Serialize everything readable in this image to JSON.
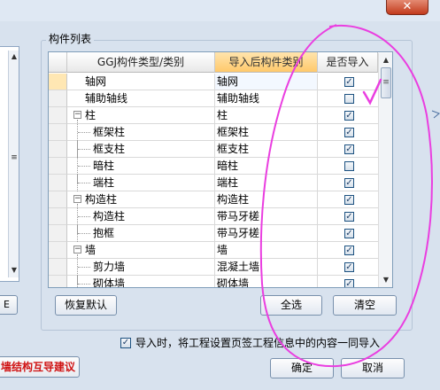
{
  "window": {
    "close_glyph": "✕"
  },
  "left_panel": {
    "button_label": "E"
  },
  "group": {
    "title": "构件列表"
  },
  "table": {
    "headers": [
      "GGJ构件类型/类别",
      "导入后构件类别",
      "是否导入"
    ],
    "rows": [
      {
        "name": "轴网",
        "target": "轴网",
        "checked": true,
        "level": 0,
        "has_toggle": false,
        "selected": true
      },
      {
        "name": "辅助轴线",
        "target": "辅助轴线",
        "checked": false,
        "level": 0,
        "has_toggle": false,
        "selected": false
      },
      {
        "name": "柱",
        "target": "柱",
        "checked": true,
        "level": 0,
        "has_toggle": true,
        "selected": false
      },
      {
        "name": "框架柱",
        "target": "框架柱",
        "checked": true,
        "level": 1,
        "has_toggle": false,
        "selected": false
      },
      {
        "name": "框支柱",
        "target": "框支柱",
        "checked": true,
        "level": 1,
        "has_toggle": false,
        "selected": false
      },
      {
        "name": "暗柱",
        "target": "暗柱",
        "checked": false,
        "level": 1,
        "has_toggle": false,
        "selected": false
      },
      {
        "name": "端柱",
        "target": "端柱",
        "checked": true,
        "level": 1,
        "has_toggle": false,
        "selected": false
      },
      {
        "name": "构造柱",
        "target": "构造柱",
        "checked": true,
        "level": 0,
        "has_toggle": true,
        "selected": false
      },
      {
        "name": "构造柱",
        "target": "带马牙槎",
        "checked": true,
        "level": 1,
        "has_toggle": false,
        "selected": false
      },
      {
        "name": "抱框",
        "target": "带马牙槎",
        "checked": true,
        "level": 1,
        "has_toggle": false,
        "selected": false
      },
      {
        "name": "墙",
        "target": "墙",
        "checked": true,
        "level": 0,
        "has_toggle": true,
        "selected": false
      },
      {
        "name": "剪力墙",
        "target": "混凝土墙",
        "checked": true,
        "level": 1,
        "has_toggle": false,
        "selected": false
      },
      {
        "name": "砌体墙",
        "target": "砌体墙",
        "checked": true,
        "level": 1,
        "has_toggle": false,
        "selected": false
      }
    ],
    "toggle_glyph": "−",
    "check_glyph": "✓"
  },
  "buttons": {
    "restore_default": "恢复默认",
    "select_all": "全选",
    "clear": "清空",
    "ok": "确定",
    "cancel": "取消"
  },
  "footer": {
    "import_project_info_checked": true,
    "import_project_info_label": "导入时，将工程设置页签工程信息中的内容一同导入",
    "suggestion_button": "墙结构互导建议"
  },
  "colors": {
    "accent_header": "#ffd483",
    "selected_row": "#ffe7b3",
    "annotation": "#ea3ee0",
    "warning_text": "#d01414"
  }
}
